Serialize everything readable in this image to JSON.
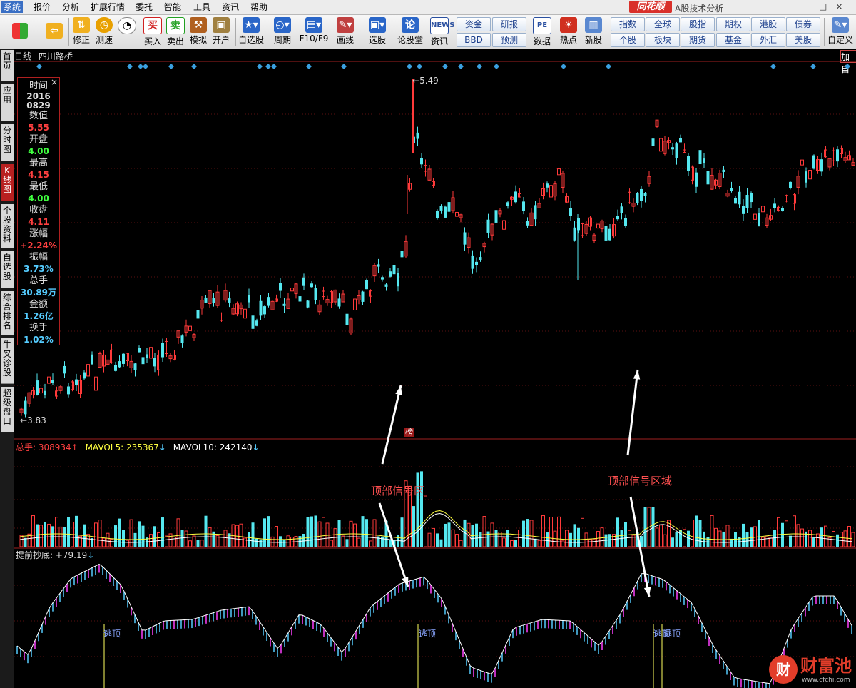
{
  "menu": {
    "items": [
      "系统",
      "报价",
      "分析",
      "扩展行情",
      "委托",
      "智能",
      "工具",
      "资讯",
      "帮助"
    ],
    "brand": "同花顺",
    "subtitle": "A股技术分析",
    "window_controls": [
      "_",
      "□",
      "×"
    ]
  },
  "toolbar": {
    "buttons": [
      {
        "label": "",
        "icon": "grid-icon",
        "color": "#d84040"
      },
      {
        "label": "",
        "icon": "back-arrow-icon",
        "color": "#e8a800"
      },
      {
        "label": "修正",
        "icon": "up-down-icon",
        "color": "#e8a800"
      },
      {
        "label": "测速",
        "icon": "clock-icon",
        "color": "#d8a000"
      },
      {
        "label": "买入",
        "icon": "buy-icon",
        "color": "#d02020"
      },
      {
        "label": "卖出",
        "icon": "sell-icon",
        "color": "#20a020"
      },
      {
        "label": "模拟",
        "icon": "hammer-icon",
        "color": "#b06020"
      },
      {
        "label": "开户",
        "icon": "lock-icon",
        "color": "#a08040"
      },
      {
        "label": "自选股",
        "icon": "star-icon",
        "color": "#2060c0"
      },
      {
        "label": "周期",
        "icon": "cycle-icon",
        "color": "#2060c0"
      },
      {
        "label": "F10/F9",
        "icon": "f10-icon",
        "color": "#2060c0"
      },
      {
        "label": "画线",
        "icon": "pencil-icon",
        "color": "#c04040"
      },
      {
        "label": "选股",
        "icon": "monitor-icon",
        "color": "#2060c0"
      },
      {
        "label": "论股堂",
        "icon": "forum-icon",
        "color": "#2060c0"
      },
      {
        "label": "资讯",
        "icon": "news-icon",
        "color": "#2060c0"
      },
      {
        "label": "数据",
        "icon": "pe-icon",
        "color": "#2060c0"
      },
      {
        "label": "热点",
        "icon": "hot-icon",
        "color": "#d03020"
      },
      {
        "label": "新股",
        "icon": "new-stock-icon",
        "color": "#2060c0"
      },
      {
        "label": "自定义",
        "icon": "custom-icon",
        "color": "#2060c0"
      }
    ],
    "news_text": "NEWS",
    "small_buttons": [
      "资金",
      "BBD",
      "研报",
      "预测",
      "指数",
      "个股",
      "全球",
      "板块",
      "股指",
      "期货",
      "期权",
      "基金",
      "港股",
      "外汇",
      "债券",
      "美股"
    ]
  },
  "chart_header": {
    "period": "日线",
    "stock_name": "四川路桥",
    "add_label": "加自"
  },
  "left_tabs": [
    "首页",
    "应用",
    "分时图",
    "K线图",
    "个股资料",
    "自选股",
    "综合排名",
    "牛叉诊股",
    "超级盘口"
  ],
  "info_panel": {
    "fields": [
      {
        "label": "时间",
        "value": "2016"
      },
      {
        "label": "",
        "value": "0829"
      },
      {
        "label": "数值",
        "value": "5.55"
      },
      {
        "label": "开盘",
        "value": "4.00"
      },
      {
        "label": "最高",
        "value": "4.15"
      },
      {
        "label": "最低",
        "value": "4.00"
      },
      {
        "label": "收盘",
        "value": "4.11"
      },
      {
        "label": "涨幅",
        "value": "+2.24%"
      },
      {
        "label": "振幅",
        "value": "3.73%"
      },
      {
        "label": "总手",
        "value": "30.89万"
      },
      {
        "label": "金额",
        "value": "1.26亿"
      },
      {
        "label": "换手",
        "value": "1.02%"
      }
    ],
    "colors": {
      "up": "#ff4040",
      "down": "#40ff40",
      "flat": "#55ccff"
    },
    "close_icon": "×"
  },
  "price_annotations": {
    "high": "5.49",
    "low": "3.83"
  },
  "volume_panel": {
    "label": "总手: 308934",
    "mavol5": "MAVOL5: 235367",
    "mavol10": "MAVOL10: 242140",
    "rank_badge": "榜"
  },
  "indicator_panel": {
    "label": "提前抄底: +79.19",
    "signal_text": "逃顶"
  },
  "annotations": {
    "text1": "顶部信号区",
    "text2": "顶部信号区域"
  },
  "watermark": {
    "logo": "财",
    "text": "财富池",
    "url": "www.cfchi.com"
  }
}
